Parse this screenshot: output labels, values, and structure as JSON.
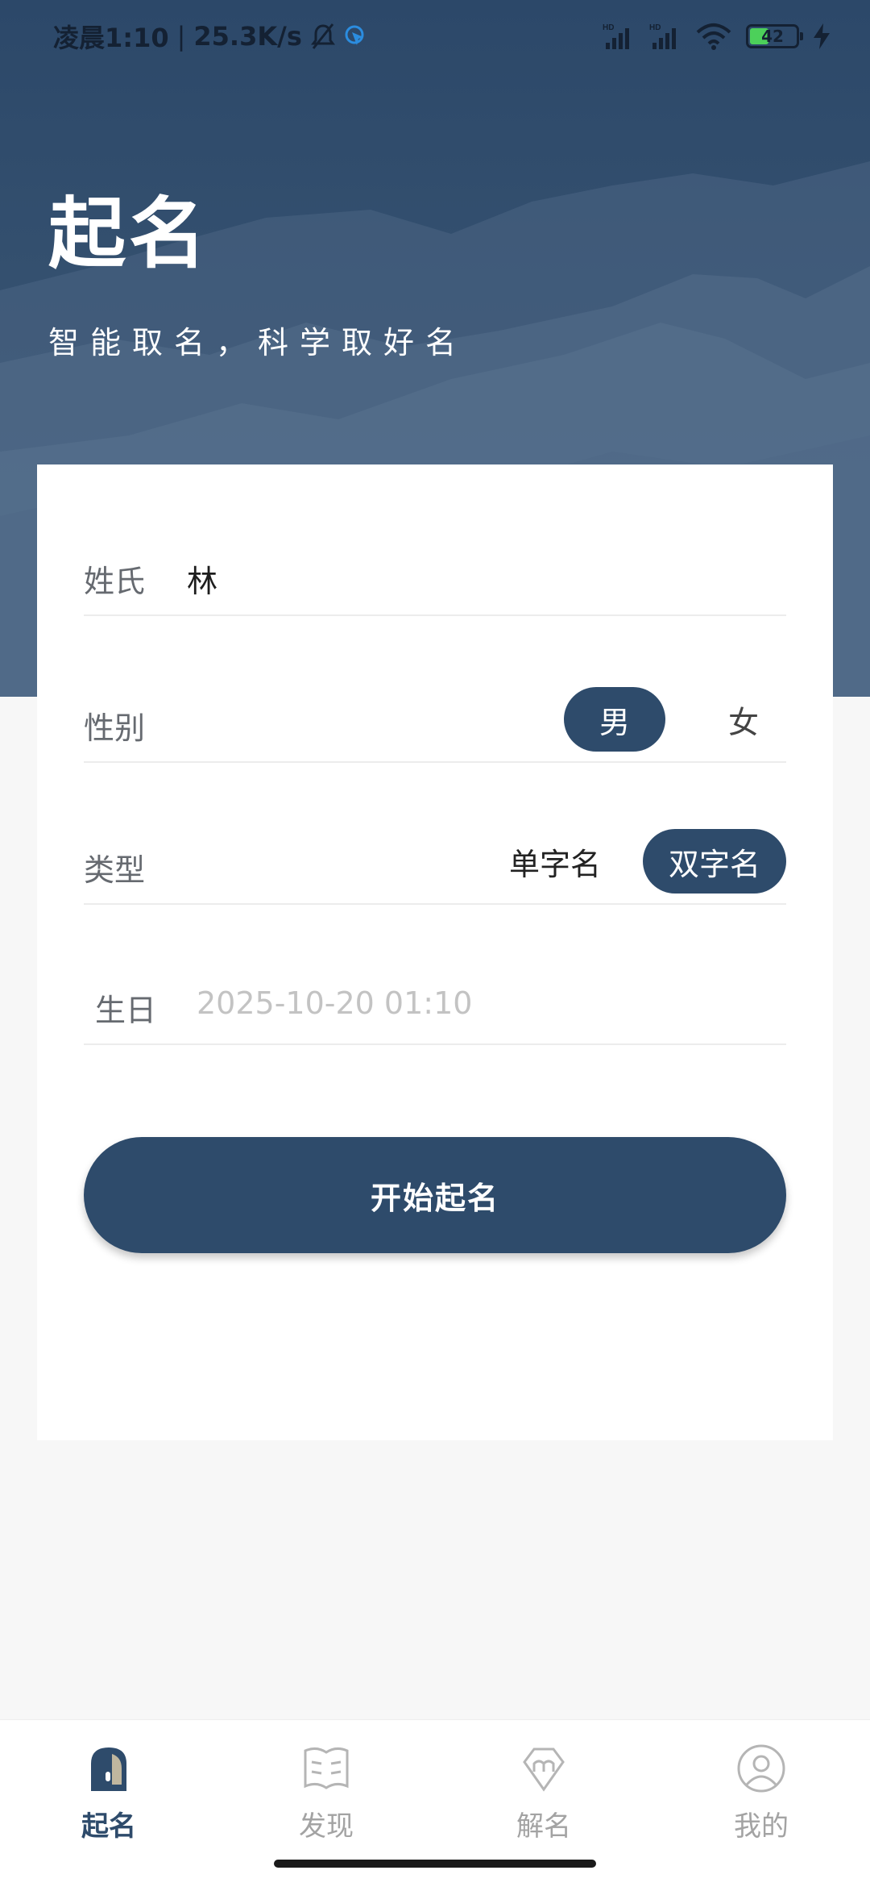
{
  "status_bar": {
    "time": "凌晨1:10",
    "net_speed": "25.3K/s",
    "battery": "42",
    "signal1": "HD",
    "signal2": "HD"
  },
  "header": {
    "title": "起名",
    "subtitle": "智能取名，科学取好名"
  },
  "form": {
    "surname": {
      "label": "姓氏",
      "value": "林"
    },
    "gender": {
      "label": "性别",
      "options": [
        "男",
        "女"
      ],
      "selected": "男"
    },
    "type": {
      "label": "类型",
      "options": [
        "单字名",
        "双字名"
      ],
      "selected": "双字名"
    },
    "birthday": {
      "label": "生日",
      "value": "2025-10-20 01:10"
    },
    "submit_label": "开始起名"
  },
  "tabs": [
    {
      "label": "起名",
      "icon": "name-door-icon",
      "active": true
    },
    {
      "label": "发现",
      "icon": "book-icon",
      "active": false
    },
    {
      "label": "解名",
      "icon": "m-badge-icon",
      "active": false
    },
    {
      "label": "我的",
      "icon": "person-icon",
      "active": false
    }
  ],
  "colors": {
    "primary": "#2e4b6b",
    "hero_bg": "#34506f",
    "inactive_tab": "#a3a3a3",
    "placeholder": "#c3c3c3"
  }
}
